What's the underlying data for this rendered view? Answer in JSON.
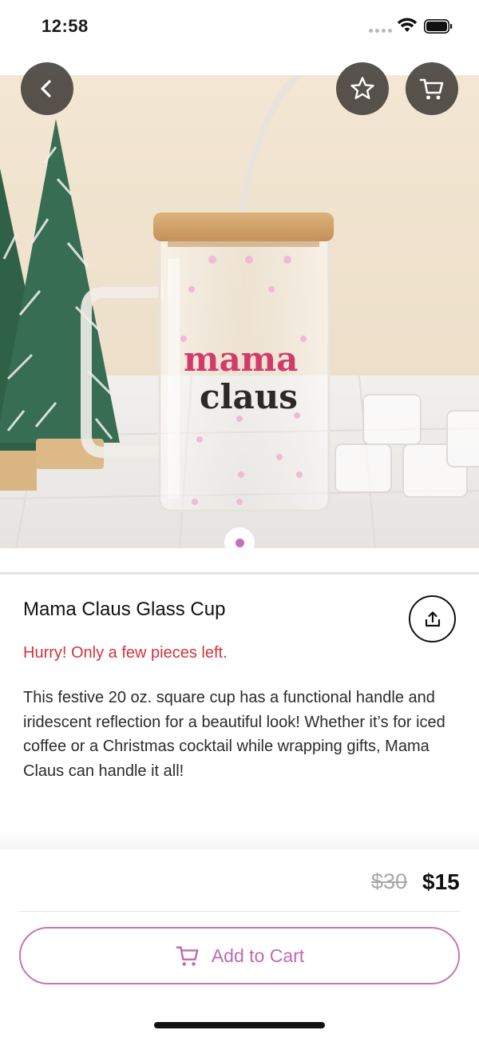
{
  "status_bar": {
    "time": "12:58"
  },
  "product": {
    "title": "Mama Claus Glass Cup",
    "stock_note": "Hurry! Only a few pieces left.",
    "description": "This festive 20 oz. square cup has a functional handle and iridescent reflection for a beautiful look! Whether it’s for iced coffee or a Christmas cocktail while wrapping gifts, Mama Claus can handle it all!",
    "cup_print": {
      "line1": "mama",
      "line2": "claus"
    },
    "image_page": {
      "current": 1,
      "total": 1
    }
  },
  "pricing": {
    "original": "$30",
    "sale": "$15"
  },
  "actions": {
    "add_to_cart_label": "Add to Cart"
  },
  "icons": {
    "back": "chevron-left-icon",
    "favorite": "star-icon",
    "cart": "cart-icon",
    "share": "share-icon"
  },
  "colors": {
    "accent": "#c06aaf",
    "stock_warning": "#d0353b",
    "overlay_button": "#403c37"
  }
}
